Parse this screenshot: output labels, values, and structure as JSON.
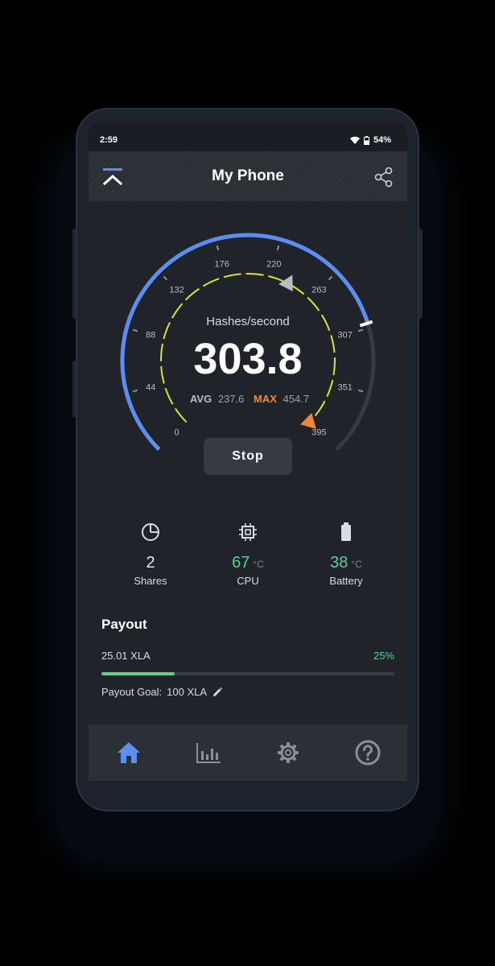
{
  "status_bar": {
    "time": "2:59",
    "battery": "54%"
  },
  "app_bar": {
    "title": "My Phone"
  },
  "gauge": {
    "label": "Hashes/second",
    "value": "303.8",
    "value_number": 303.8,
    "max_scale": 395,
    "avg_label": "AVG",
    "avg_value": "237.6",
    "max_label": "MAX",
    "max_value": "454.7",
    "ticks": [
      "0",
      "44",
      "88",
      "132",
      "176",
      "220",
      "263",
      "307",
      "351",
      "395"
    ],
    "colors": {
      "active": "#5b8ef0",
      "inactive": "#353a43",
      "inner": "#d7e23a",
      "max_marker": "#f0883a",
      "avg_marker": "#b8bcc4"
    }
  },
  "controls": {
    "stop_label": "Stop"
  },
  "stats": {
    "shares": {
      "value": "2",
      "label": "Shares",
      "icon": "pie-chart-icon"
    },
    "cpu": {
      "value": "67",
      "unit": "°C",
      "label": "CPU",
      "icon": "cpu-chip-icon"
    },
    "battery": {
      "value": "38",
      "unit": "°C",
      "label": "Battery",
      "icon": "battery-icon"
    }
  },
  "payout": {
    "title": "Payout",
    "amount": "25.01 XLA",
    "percent": "25%",
    "progress_fraction": 0.25,
    "goal_label": "Payout Goal:",
    "goal_value": "100 XLA"
  },
  "nav": {
    "items": [
      {
        "name": "home",
        "icon": "home-icon",
        "active": true
      },
      {
        "name": "stats",
        "icon": "bar-chart-icon",
        "active": false
      },
      {
        "name": "settings",
        "icon": "gear-icon",
        "active": false
      },
      {
        "name": "help",
        "icon": "help-circle-icon",
        "active": false
      }
    ]
  }
}
